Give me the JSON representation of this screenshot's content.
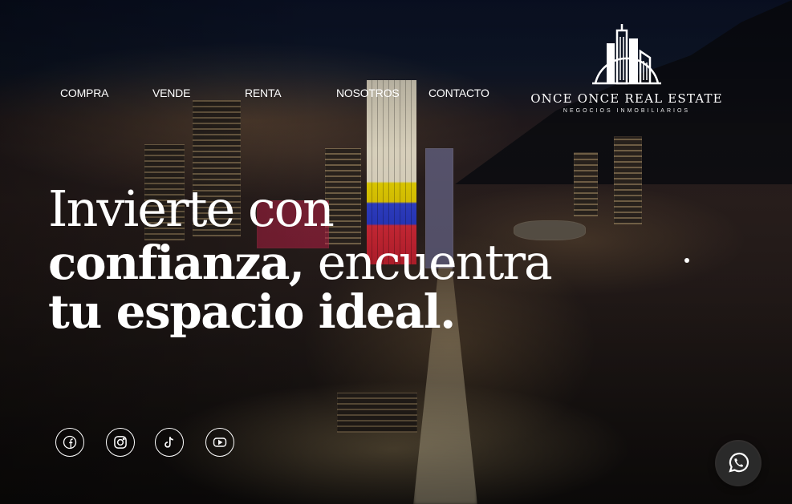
{
  "nav": {
    "items": [
      {
        "label": "COMPRA"
      },
      {
        "label": "VENDE"
      },
      {
        "label": "RENTA"
      },
      {
        "label": "NOSOTROS"
      },
      {
        "label": "CONTACTO"
      }
    ]
  },
  "logo": {
    "name": "ONCE ONCE REAL ESTATE",
    "tagline": "NEGOCIOS INMOBILIARIOS",
    "icon": "buildings-logo-icon"
  },
  "hero": {
    "line1": "Invierte con",
    "line2_bold": "confianza,",
    "line2_light": " encuentra",
    "line3_bold": "tu espacio ideal."
  },
  "social": [
    {
      "icon": "facebook-icon"
    },
    {
      "icon": "instagram-icon"
    },
    {
      "icon": "tiktok-icon"
    },
    {
      "icon": "youtube-icon"
    }
  ],
  "whatsapp": {
    "icon": "whatsapp-icon"
  },
  "colors": {
    "text": "#ffffff",
    "whatsapp_bg": "#2a2a2a"
  }
}
